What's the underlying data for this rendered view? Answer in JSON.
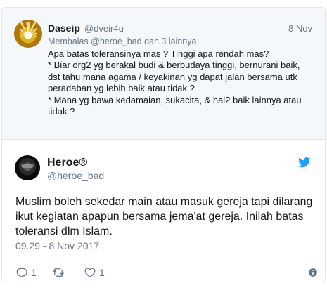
{
  "parent_tweet": {
    "author_name": "Daseip",
    "author_handle": "@dveir4u",
    "date": "8 Nov",
    "replying_to": "Membalas @heroe_bad dan 3 lainnya",
    "text": "Apa batas toleransinya mas ? Tinggi apa rendah mas?\n* Biar org2 yg berakal budi & berbudaya tinggi, bernurani baik, dst tahu mana agama / keyakinan yg dapat jalan bersama utk peradaban yg lebih baik atau tidak ?\n* Mana yg bawa kedamaian, sukacita, & hal2 baik lainnya atau tidak ?"
  },
  "main_tweet": {
    "author_name": "Heroe®",
    "author_handle": "@heroe_bad",
    "text": "Muslim boleh sekedar main atau masuk gereja tapi dilarang ikut kegiatan apapun bersama jema'at gereja. Inilah batas toleransi dlm Islam.",
    "timestamp": "09.29 - 8 Nov 2017",
    "actions": {
      "reply_count": "1",
      "retweet_count": "",
      "like_count": "1"
    }
  },
  "colors": {
    "twitter_blue": "#1da1f2",
    "muted": "#657786"
  },
  "icons": {
    "reply": "reply-icon",
    "retweet": "retweet-icon",
    "like": "heart-icon",
    "info": "info-icon",
    "brand": "twitter-bird-icon"
  }
}
